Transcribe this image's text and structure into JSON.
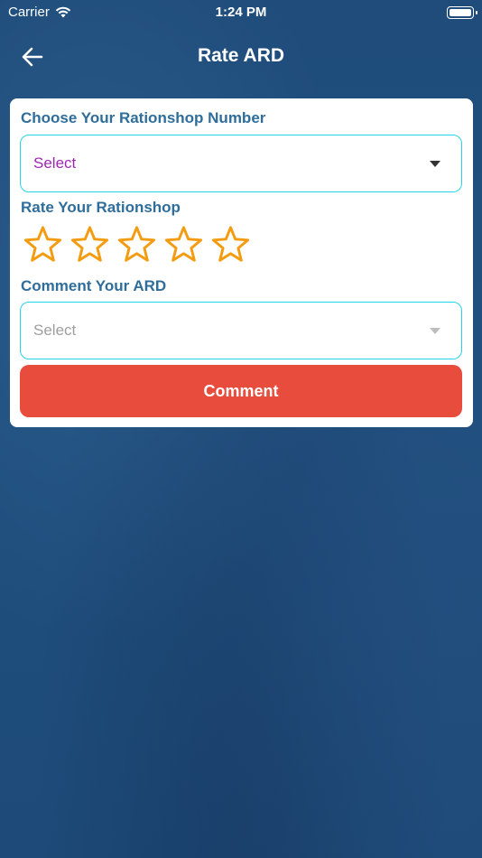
{
  "status_bar": {
    "carrier": "Carrier",
    "time": "1:24 PM"
  },
  "header": {
    "title": "Rate ARD",
    "back_icon": "arrow-left-icon"
  },
  "form": {
    "rationshop_label": "Choose Your Rationshop Number",
    "rationshop_select": {
      "value": "Select",
      "text_color": "#9c27b0"
    },
    "rating_label": "Rate Your Rationshop",
    "rating": {
      "value": 0,
      "max": 5,
      "star_color": "#f39c12"
    },
    "comment_label": "Comment Your ARD",
    "comment_select": {
      "value": "Select",
      "text_color": "#9e9e9e"
    },
    "submit_label": "Comment"
  },
  "colors": {
    "label": "#2f6d9b",
    "field_border": "#25d3e6",
    "button": "#e74c3c"
  }
}
